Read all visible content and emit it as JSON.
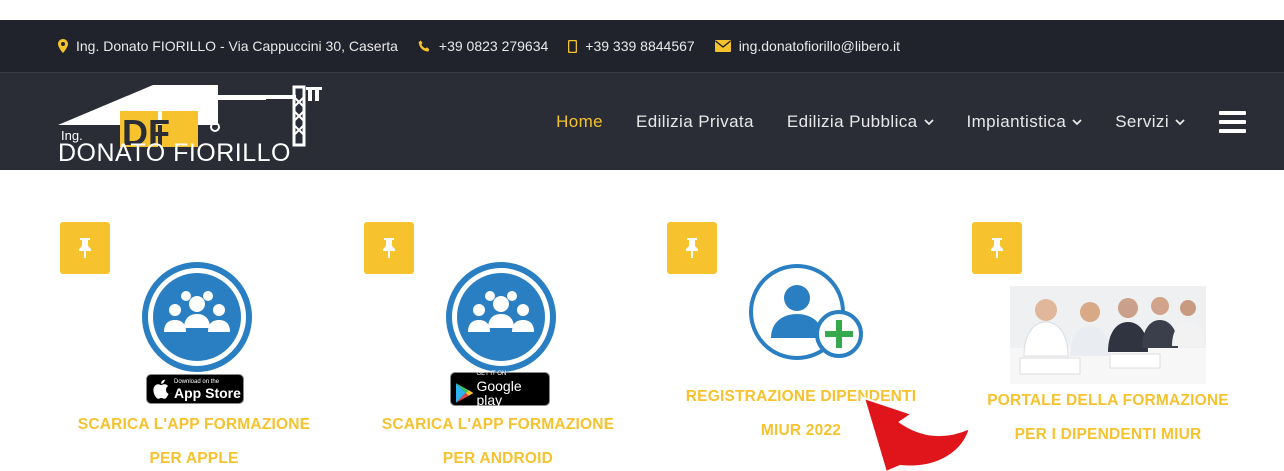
{
  "topbar": {
    "address": "Ing. Donato FIORILLO - Via Cappuccini 30, Caserta",
    "phone": "+39 0823 279634",
    "mobile": "+39 339 8844567",
    "email": "ing.donatofiorillo@libero.it"
  },
  "logo": {
    "prefix": "Ing.",
    "initials": "DF",
    "name": "DONATO FIORILLO"
  },
  "nav": {
    "home": "Home",
    "private": "Edilizia Privata",
    "public": "Edilizia Pubblica",
    "plants": "Impiantistica",
    "services": "Servizi"
  },
  "cards": [
    {
      "line1": "SCARICA L'APP FORMAZIONE",
      "line2": "PER APPLE",
      "badge_small": "Download on the",
      "badge_big": "App Store"
    },
    {
      "line1": "SCARICA L'APP FORMAZIONE",
      "line2": "PER ANDROID",
      "badge_small": "GET IT ON",
      "badge_big": "Google play"
    },
    {
      "line1": "REGISTRAZIONE DIPENDENTI",
      "line2": "MIUR 2022"
    },
    {
      "line1": "PORTALE DELLA FORMAZIONE",
      "line2": "PER I DIPENDENTI MIUR"
    }
  ],
  "colors": {
    "accent": "#f6c22e",
    "dark": "#2a2d36",
    "topbar": "#20232b",
    "blue": "#2a7fc2",
    "green": "#35a94b",
    "red": "#e0151b"
  }
}
